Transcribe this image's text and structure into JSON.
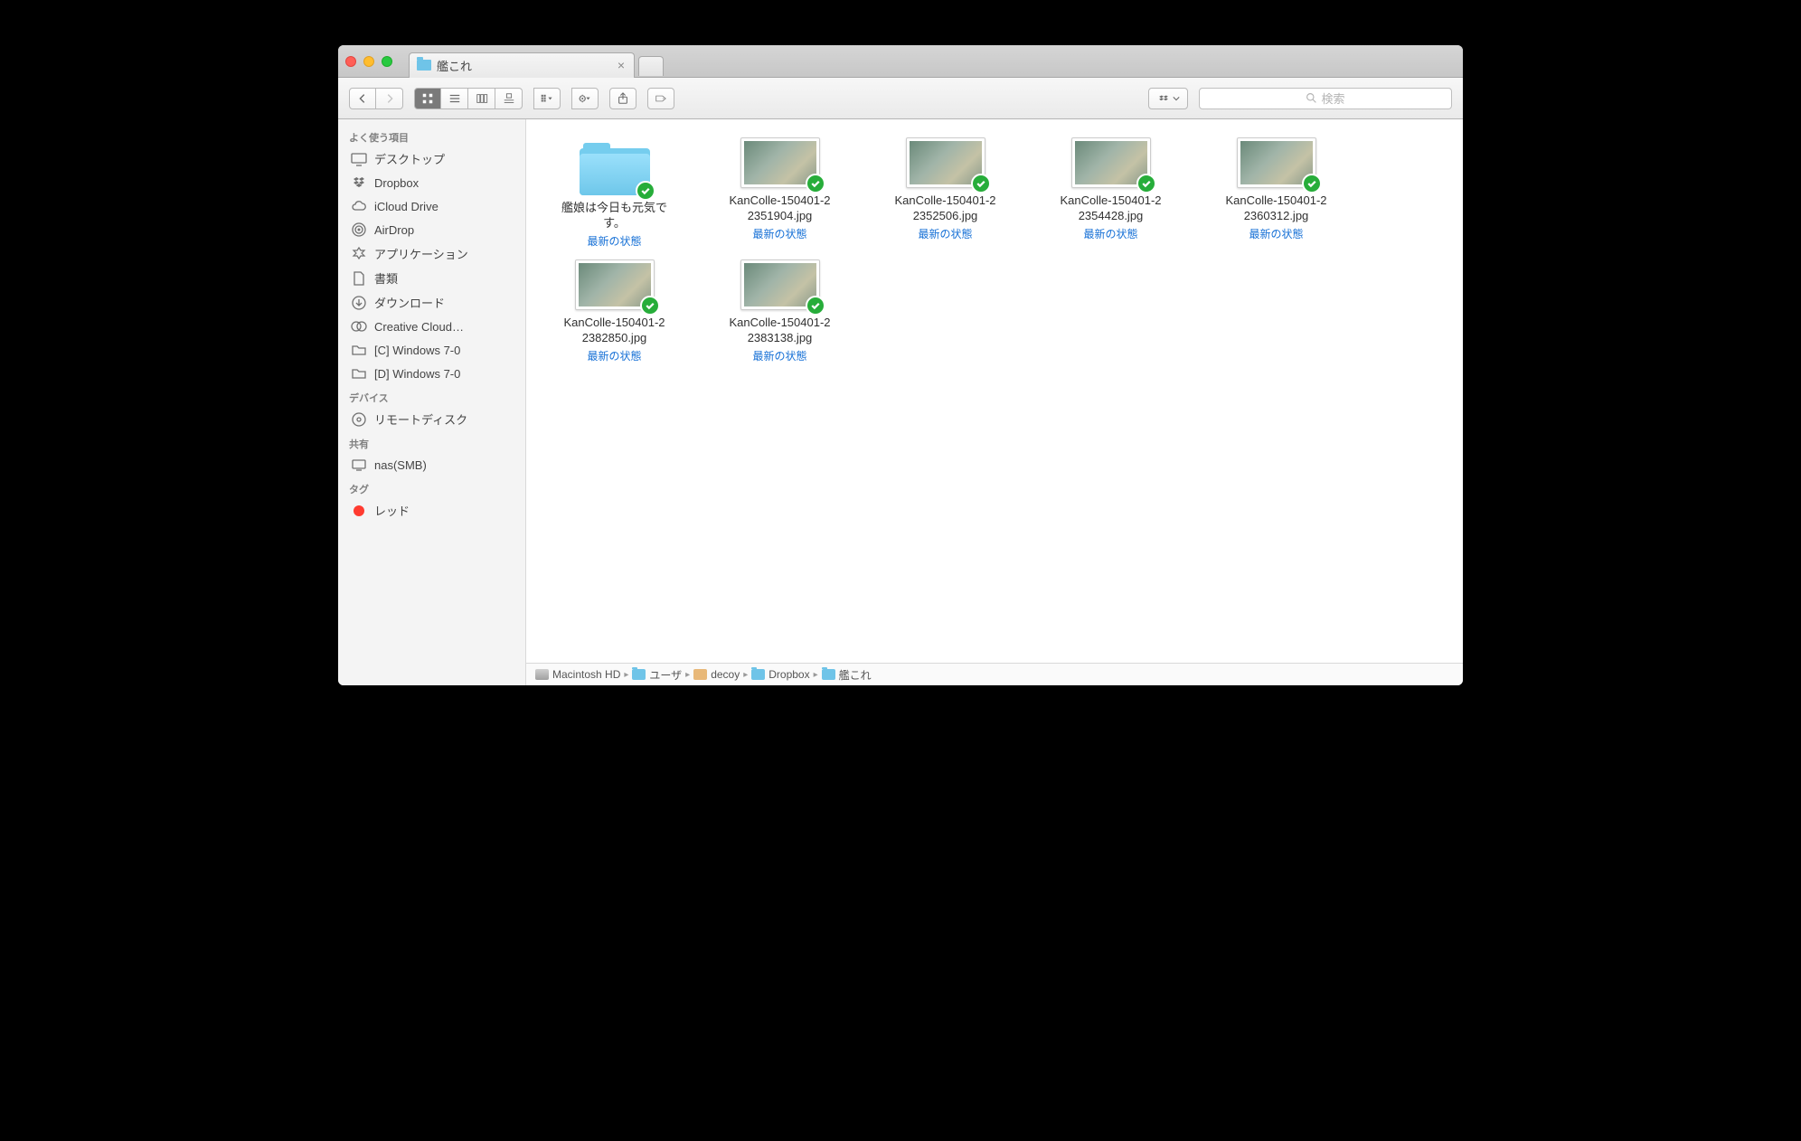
{
  "tab": {
    "title": "艦これ",
    "close": "×"
  },
  "toolbar": {
    "search_placeholder": "検索"
  },
  "sidebar": {
    "sections": [
      {
        "header": "よく使う項目",
        "items": [
          {
            "label": "デスクトップ",
            "icon": "desktop"
          },
          {
            "label": "Dropbox",
            "icon": "dropbox"
          },
          {
            "label": "iCloud Drive",
            "icon": "cloud"
          },
          {
            "label": "AirDrop",
            "icon": "airdrop"
          },
          {
            "label": "アプリケーション",
            "icon": "apps"
          },
          {
            "label": "書類",
            "icon": "doc"
          },
          {
            "label": "ダウンロード",
            "icon": "download"
          },
          {
            "label": "Creative Cloud…",
            "icon": "cc"
          },
          {
            "label": "[C] Windows 7-0",
            "icon": "folder"
          },
          {
            "label": "[D] Windows 7-0",
            "icon": "folder"
          }
        ]
      },
      {
        "header": "デバイス",
        "items": [
          {
            "label": "リモートディスク",
            "icon": "disc"
          }
        ]
      },
      {
        "header": "共有",
        "items": [
          {
            "label": "nas(SMB)",
            "icon": "net"
          }
        ]
      },
      {
        "header": "タグ",
        "items": [
          {
            "label": "レッド",
            "icon": "tag-red"
          }
        ]
      }
    ]
  },
  "files": [
    {
      "type": "folder",
      "name_l1": "艦娘は今日も元気で",
      "name_l2": "す。",
      "status": "最新の状態"
    },
    {
      "type": "image",
      "name_l1": "KanColle-150401-2",
      "name_l2": "2351904.jpg",
      "status": "最新の状態"
    },
    {
      "type": "image",
      "name_l1": "KanColle-150401-2",
      "name_l2": "2352506.jpg",
      "status": "最新の状態"
    },
    {
      "type": "image",
      "name_l1": "KanColle-150401-2",
      "name_l2": "2354428.jpg",
      "status": "最新の状態"
    },
    {
      "type": "image",
      "name_l1": "KanColle-150401-2",
      "name_l2": "2360312.jpg",
      "status": "最新の状態"
    },
    {
      "type": "image",
      "name_l1": "KanColle-150401-2",
      "name_l2": "2382850.jpg",
      "status": "最新の状態"
    },
    {
      "type": "image",
      "name_l1": "KanColle-150401-2",
      "name_l2": "2383138.jpg",
      "status": "最新の状態"
    }
  ],
  "pathbar": [
    {
      "label": "Macintosh HD",
      "icon": "hd"
    },
    {
      "label": "ユーザ",
      "icon": "fold"
    },
    {
      "label": "decoy",
      "icon": "home"
    },
    {
      "label": "Dropbox",
      "icon": "fold"
    },
    {
      "label": "艦これ",
      "icon": "fold"
    }
  ]
}
